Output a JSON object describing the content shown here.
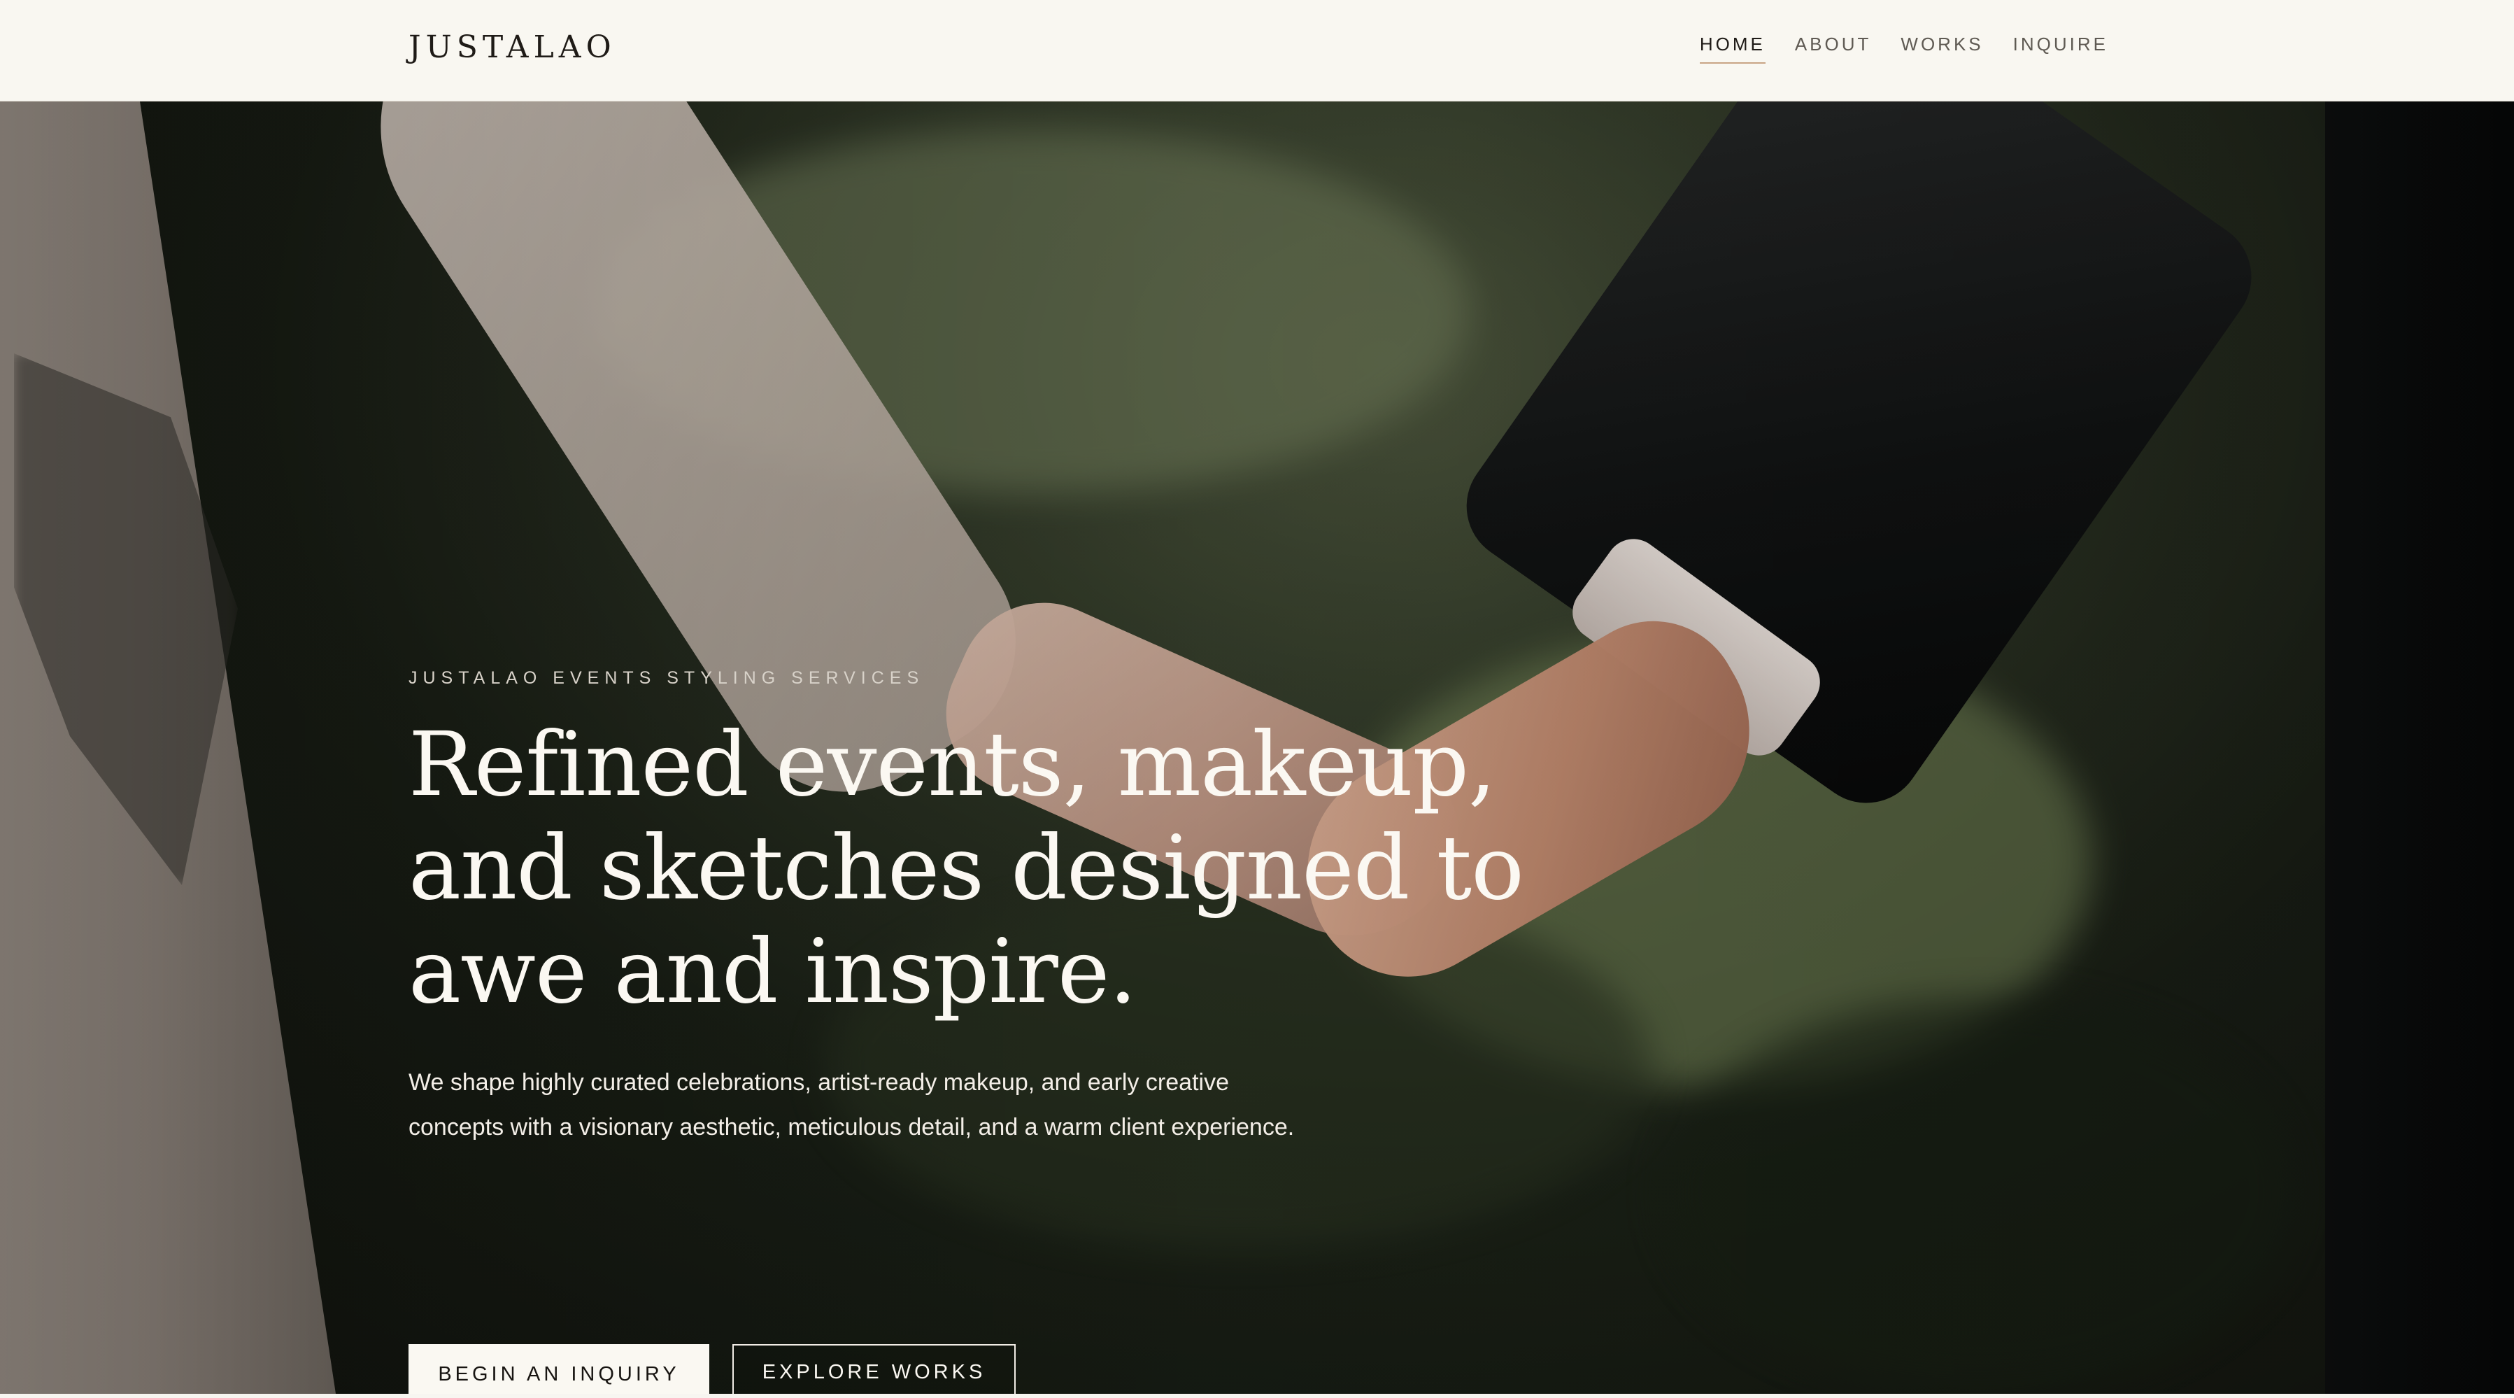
{
  "header": {
    "logo": "JUSTALAO",
    "nav": [
      {
        "label": "HOME",
        "active": true
      },
      {
        "label": "ABOUT",
        "active": false
      },
      {
        "label": "WORKS",
        "active": false
      },
      {
        "label": "INQUIRE",
        "active": false
      }
    ]
  },
  "hero": {
    "eyebrow": "JUSTALAO EVENTS STYLING SERVICES",
    "headline_lines": [
      "Refined events, makeup,",
      "and sketches designed to",
      "awe and inspire."
    ],
    "lede": "We shape highly curated celebrations, artist-ready makeup, and early creative concepts with a visionary aesthetic, meticulous detail, and a warm client experience.",
    "buttons": {
      "primary": "BEGIN AN INQUIRY",
      "secondary": "EXPLORE WORKS"
    }
  },
  "colors": {
    "background": "#f9f7f1",
    "text_dark": "#1f1b17",
    "nav_active_underline": "#c9a485",
    "hero_text": "#fbf8f2"
  },
  "icons": []
}
